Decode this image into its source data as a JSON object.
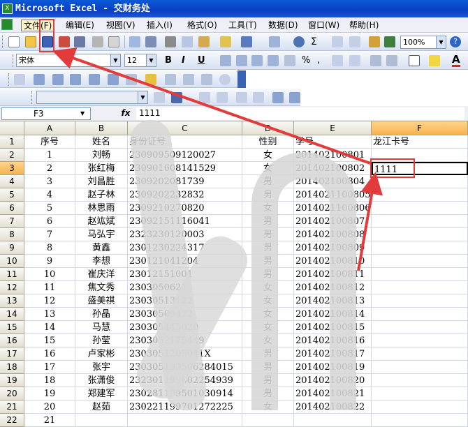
{
  "window": {
    "title": "Microsoft Excel - 交财务处"
  },
  "menu": [
    "文件(F)",
    "编辑(E)",
    "视图(V)",
    "插入(I)",
    "格式(O)",
    "工具(T)",
    "数据(D)",
    "窗口(W)",
    "帮助(H)"
  ],
  "toolbar": {
    "zoom": "100%",
    "font": "宋体",
    "size": "12"
  },
  "formula": {
    "namebox": "F3",
    "fx": "fx",
    "value": "1111"
  },
  "columns": [
    "A",
    "B",
    "C",
    "D",
    "E",
    "F"
  ],
  "rows": [
    {
      "n": "1",
      "cells": [
        "序号",
        "姓名",
        "身份证号",
        "性别",
        "学号",
        "龙江卡号"
      ]
    },
    {
      "n": "2",
      "cells": [
        "1",
        "刘畅",
        "230909509120027",
        "女",
        "201402100801",
        ""
      ]
    },
    {
      "n": "3",
      "cells": [
        "2",
        "张红梅",
        "230901608141529",
        "女",
        "201402100802",
        "1111"
      ]
    },
    {
      "n": "4",
      "cells": [
        "3",
        "刘昌胜",
        "2309202081739",
        "男",
        "201402100804",
        ""
      ]
    },
    {
      "n": "5",
      "cells": [
        "4",
        "赵子林",
        "2309202232832",
        "男",
        "2014021100805",
        ""
      ]
    },
    {
      "n": "6",
      "cells": [
        "5",
        "林思雨",
        "2309210270820",
        "女",
        "2014021100806",
        ""
      ]
    },
    {
      "n": "7",
      "cells": [
        "6",
        "赵竑斌",
        "23092151116041",
        "男",
        "201402100807",
        ""
      ]
    },
    {
      "n": "8",
      "cells": [
        "7",
        "马弘宇",
        "2323230120003",
        "男",
        "201402100808",
        ""
      ]
    },
    {
      "n": "9",
      "cells": [
        "8",
        "黄鑫",
        "2301230224317",
        "男",
        "201402100809",
        ""
      ]
    },
    {
      "n": "10",
      "cells": [
        "9",
        "李想",
        "230121041204",
        "男",
        "201402100810",
        ""
      ]
    },
    {
      "n": "11",
      "cells": [
        "10",
        "崔庆洋",
        "23012151001",
        "男",
        "201402100811",
        ""
      ]
    },
    {
      "n": "12",
      "cells": [
        "11",
        "焦文秀",
        "2303050621",
        "女",
        "201402100812",
        ""
      ]
    },
    {
      "n": "13",
      "cells": [
        "12",
        "盛美祺",
        "23030513122",
        "女",
        "201402100813",
        ""
      ]
    },
    {
      "n": "14",
      "cells": [
        "13",
        "孙晶",
        "23030509422",
        "女",
        "201402100814",
        ""
      ]
    },
    {
      "n": "15",
      "cells": [
        "14",
        "马慧",
        "230305445020",
        "女",
        "201402100815",
        ""
      ]
    },
    {
      "n": "16",
      "cells": [
        "15",
        "孙莹",
        "2303052175449",
        "女",
        "201402100816",
        ""
      ]
    },
    {
      "n": "17",
      "cells": [
        "16",
        "卢家彬",
        "2303051205041X",
        "男",
        "201402100817",
        ""
      ]
    },
    {
      "n": "18",
      "cells": [
        "17",
        "张宇",
        "230305199506284015",
        "男",
        "201402100819",
        ""
      ]
    },
    {
      "n": "19",
      "cells": [
        "18",
        "张潇俊",
        "232301199602254939",
        "男",
        "201402100820",
        ""
      ]
    },
    {
      "n": "20",
      "cells": [
        "19",
        "郑建军",
        "230281199501030914",
        "男",
        "201402100821",
        ""
      ]
    },
    {
      "n": "21",
      "cells": [
        "20",
        "赵茹",
        "230221199701272225",
        "女",
        "201402100822",
        ""
      ]
    },
    {
      "n": "22",
      "cells": [
        "21",
        "",
        "",
        "",
        "",
        ""
      ]
    }
  ],
  "colors": {
    "title_bar": "#0a4ad0",
    "annotation": "#e23b3b",
    "selected_header": "#f7b24d"
  }
}
